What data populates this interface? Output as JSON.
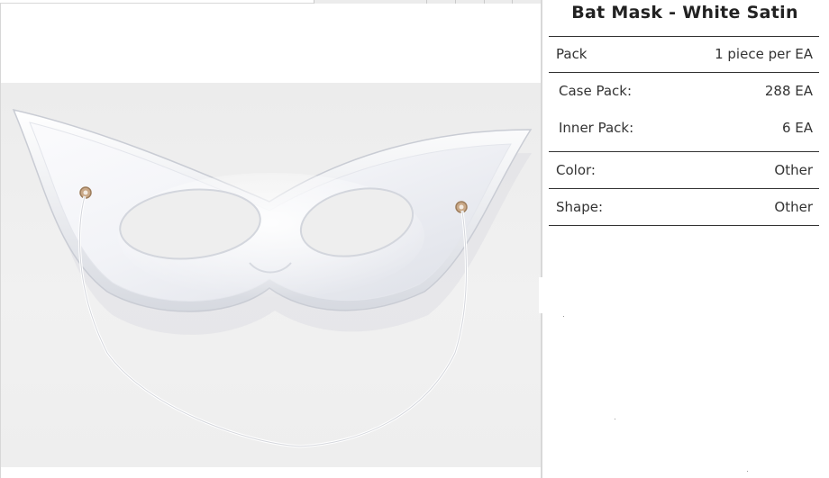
{
  "product": {
    "title": "Bat Mask - White Satin",
    "image_alt": "White satin bat mask with elastic string"
  },
  "specs": [
    {
      "label": "Pack",
      "value": "1 piece per EA"
    },
    {
      "label": "Case Pack:",
      "value": "288 EA"
    },
    {
      "label": "Inner Pack:",
      "value": "6 EA"
    },
    {
      "label": "Color:",
      "value": "Other"
    },
    {
      "label": "Shape:",
      "value": "Other"
    }
  ],
  "colors": {
    "text": "#333333",
    "title": "#222222",
    "rule": "#333333",
    "photo_background": "#eeeeee"
  }
}
